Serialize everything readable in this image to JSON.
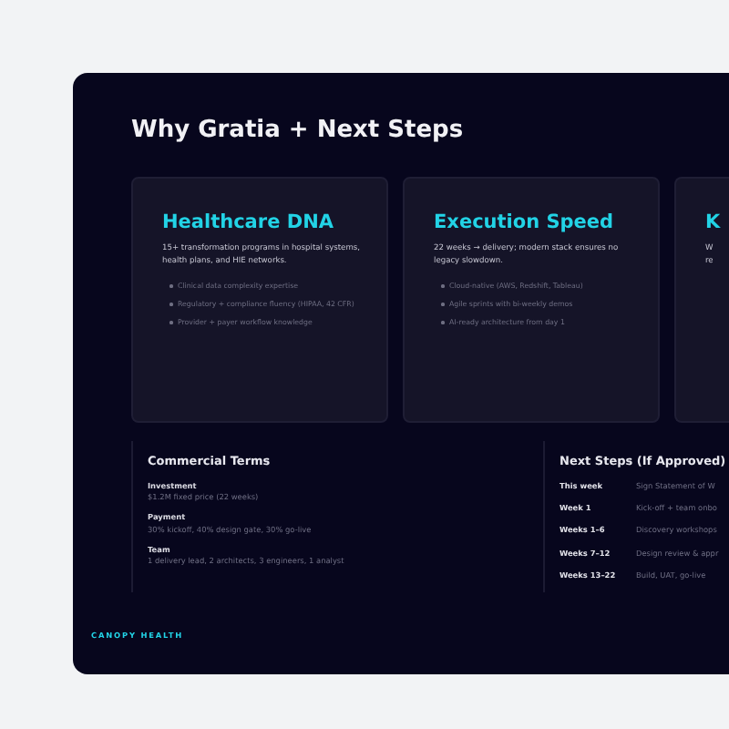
{
  "title": "Why Gratia + Next Steps",
  "cards": [
    {
      "title": "Healthcare DNA",
      "description": "15+ transformation programs in hospital systems, health plans, and HIE networks.",
      "bullets": [
        "Clinical data complexity expertise",
        "Regulatory + compliance fluency (HIPAA, 42 CFR)",
        "Provider + payer workflow knowledge"
      ]
    },
    {
      "title": "Execution Speed",
      "description": "22 weeks → delivery; modern stack ensures no legacy slowdown.",
      "bullets": [
        "Cloud-native (AWS, Redshift, Tableau)",
        "Agile sprints with bi-weekly demos",
        "AI-ready architecture from day 1"
      ]
    },
    {
      "title": "K",
      "description": "W\nre"
    }
  ],
  "commercial_terms": {
    "heading": "Commercial Terms",
    "items": [
      {
        "label": "Investment",
        "value": "$1.2M fixed price (22 weeks)"
      },
      {
        "label": "Payment",
        "value": "30% kickoff, 40% design gate, 30% go-live"
      },
      {
        "label": "Team",
        "value": "1 delivery lead, 2 architects, 3 engineers, 1 analyst"
      }
    ]
  },
  "next_steps": {
    "heading": "Next Steps (If Approved)",
    "rows": [
      {
        "when": "This week",
        "what": "Sign Statement of W"
      },
      {
        "when": "Week 1",
        "what": "Kick-off + team onbo"
      },
      {
        "when": "Weeks 1–6",
        "what": "Discovery workshops"
      },
      {
        "when": "Weeks 7–12",
        "what": "Design review & appr"
      },
      {
        "when": "Weeks 13–22",
        "what": "Build, UAT, go-live"
      }
    ]
  },
  "footer": "CANOPY HEALTH"
}
